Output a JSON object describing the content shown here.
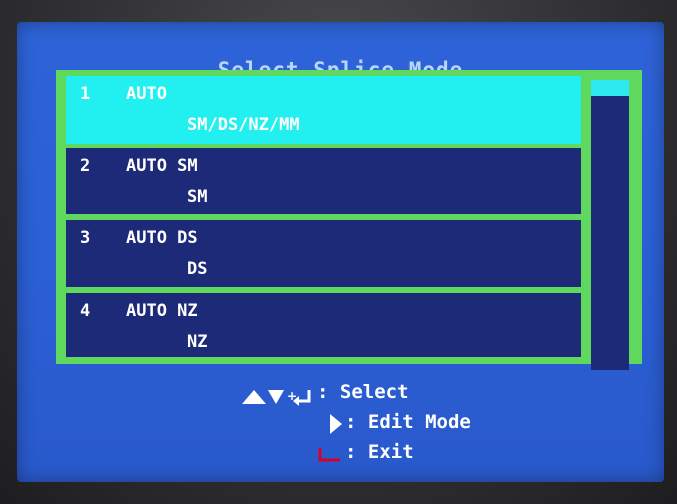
{
  "title": "Select Splice Mode",
  "items": [
    {
      "num": "1",
      "name": "AUTO",
      "sub": "SM/DS/NZ/MM",
      "selected": true
    },
    {
      "num": "2",
      "name": "AUTO SM",
      "sub": "SM",
      "selected": false
    },
    {
      "num": "3",
      "name": "AUTO DS",
      "sub": "DS",
      "selected": false
    },
    {
      "num": "4",
      "name": "AUTO NZ",
      "sub": "NZ",
      "selected": false
    }
  ],
  "scrollbar": {
    "position_fraction": 0.0
  },
  "help": [
    {
      "keys": "up-down-arrow-icon + enter-icon",
      "text": ": Select"
    },
    {
      "keys": "right-arrow-icon",
      "text": ": Edit Mode"
    },
    {
      "keys": "return-icon",
      "text": ": Exit"
    }
  ],
  "colors": {
    "screen_bg": "#2b5fd4",
    "title": "#b9d6ff",
    "frame": "#5fd85e",
    "item_bg": "#1d2a78",
    "selected_bg": "#22f0f0",
    "text": "#ffffff",
    "exit_icon": "#d8002c"
  }
}
